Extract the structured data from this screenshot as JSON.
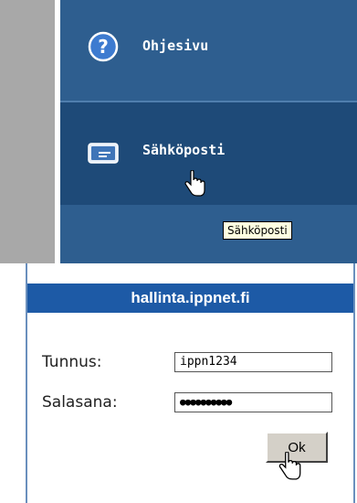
{
  "nav": {
    "items": [
      {
        "label": "Ohjesivu",
        "icon": "help-question-icon"
      },
      {
        "label": "Sähköposti",
        "icon": "mail-envelope-icon"
      }
    ],
    "tooltip": "Sähköposti"
  },
  "login": {
    "title": "hallinta.ippnet.fi",
    "username_label": "Tunnus:",
    "username_value": "ippn1234",
    "password_label": "Salasana:",
    "password_value": "●●●●●●●●●●",
    "ok_label": "Ok"
  },
  "colors": {
    "nav_bg": "#2e5e8f",
    "nav_active_bg": "#1e4a78",
    "login_header_bg": "#1d5aa6",
    "side_strip": "#a8a8a8",
    "tooltip_bg": "#ffffe1"
  }
}
